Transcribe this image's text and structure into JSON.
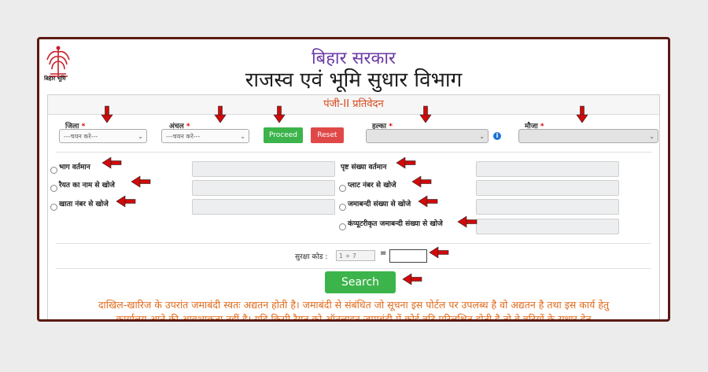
{
  "header": {
    "logo_caption": "बिहार भूमि",
    "gov_title": "बिहार सरकार",
    "dept_title": "राजस्व एवं भूमि सुधार विभाग"
  },
  "form": {
    "heading": "पंजी-II प्रतिवेदन",
    "district": {
      "label": "जिला",
      "required": "*",
      "placeholder": "---चयन करे---"
    },
    "circle": {
      "label": "अंचल",
      "required": "*",
      "placeholder": "---चयन करे---"
    },
    "proceed_label": "Proceed",
    "reset_label": "Reset",
    "halka": {
      "label": "हल्का",
      "required": "*",
      "value": ""
    },
    "mauja": {
      "label": "मौजा",
      "required": "*",
      "value": ""
    },
    "info_icon": "i",
    "search_options_left": [
      {
        "label": "भाग वर्तमान"
      },
      {
        "label": "रैयत का नाम से खोजे"
      },
      {
        "label": "खाता नंबर से खोजे"
      }
    ],
    "search_options_right": [
      {
        "label": "पृष्ट संख्या वर्तमान"
      },
      {
        "label": "प्लाट नंबर से खोजे"
      },
      {
        "label": "जमाबन्दी संख्या से खोजे"
      },
      {
        "label": "कंप्यूटरीकृत जमाबन्दी संख्या से खोजे"
      }
    ],
    "captcha": {
      "label": "सुरक्षा कोड :",
      "question": "1 + 7",
      "equals": "=",
      "answer": ""
    },
    "search_label": "Search",
    "notice_line1": "दाखिल-खारिज के उपरांत जमाबंदी स्वतः अद्यतन होती है। जमाबंदी से संबंधित जो सूचना इस पोर्टल पर उपलब्ध है वो अद्यतन है तथा इस कार्य हेतु",
    "notice_line2": "कार्यालय आने की आवश्यकता नहीं है। यदि किसी रैयत को ऑनलाइन जमाबंदी में कोई त्रुटि परिलक्षित होती है तो वे त्रुटियों के सुधार हेतु"
  },
  "colors": {
    "frame": "#5a1a12",
    "arrow": "#d10a0a",
    "proceed": "#3cb44b",
    "reset": "#e04848",
    "heading": "#d8481b",
    "notice": "#e06a1a"
  },
  "icons": [
    "emblem-logo",
    "info-icon",
    "chevron-down-icon",
    "red-arrow-icon"
  ]
}
